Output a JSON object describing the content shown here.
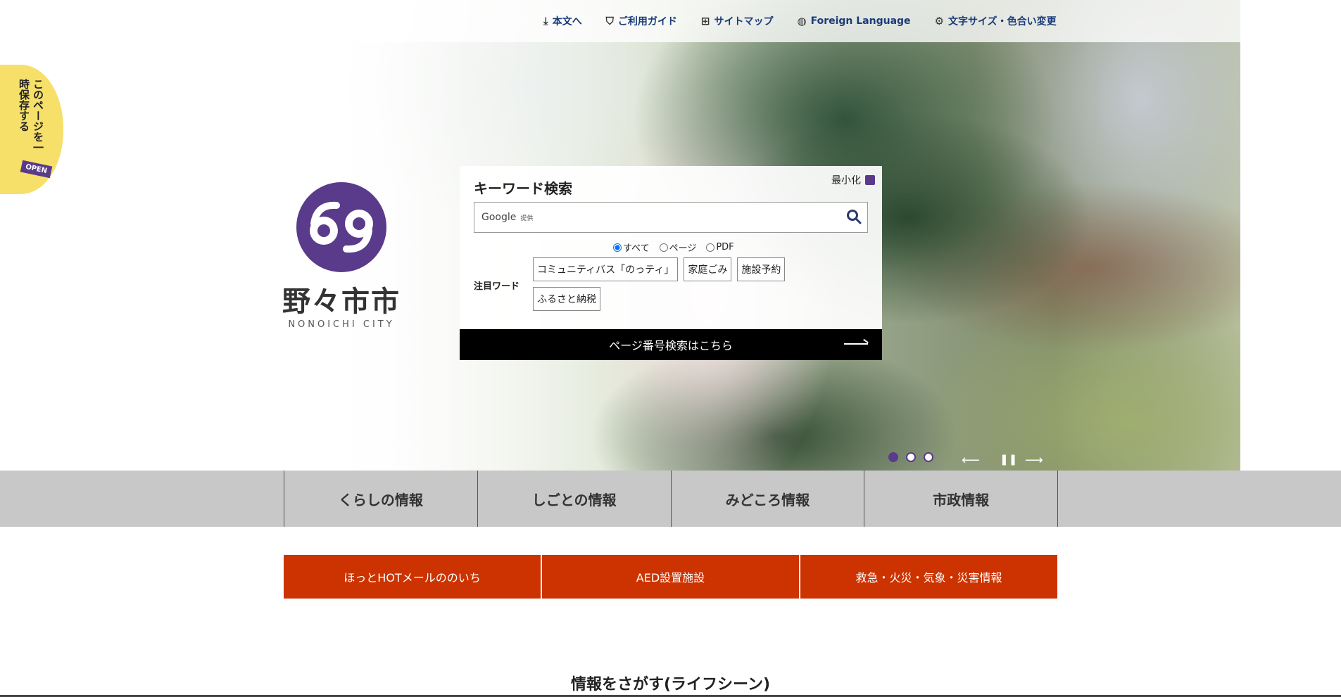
{
  "util_nav": [
    {
      "icon": "down-arrow-icon",
      "label": "本文へ"
    },
    {
      "icon": "guide-shield-icon",
      "label": "ご利用ガイド"
    },
    {
      "icon": "sitemap-icon",
      "label": "サイトマップ"
    },
    {
      "icon": "globe-icon",
      "label": "Foreign Language"
    },
    {
      "icon": "settings-icon",
      "label": "文字サイズ・色合い変更"
    }
  ],
  "save_tab": {
    "text": "このページを一時保存する",
    "badge": "OPEN"
  },
  "logo": {
    "jp": "野々市市",
    "en": "NONOICHI CITY"
  },
  "search": {
    "title": "キーワード検索",
    "minimize": "最小化",
    "placeholder": "Google",
    "placeholder_small": "提供",
    "radios": [
      "すべて",
      "ページ",
      "PDF"
    ],
    "featured_label": "注目ワード",
    "tags": [
      "コミュニティバス「のっティ」",
      "家庭ごみ",
      "施設予約",
      "ふるさと納税"
    ],
    "page_number_button": "ページ番号検索はこちら"
  },
  "slider": {
    "prev": "⟵",
    "pause": "❚❚",
    "next": "⟶"
  },
  "global_nav": [
    "くらしの情報",
    "しごとの情報",
    "みどころ情報",
    "市政情報"
  ],
  "quick_links": [
    "ほっとHOTメールののいち",
    "AED設置施設",
    "救急・火災・気象・災害情報"
  ],
  "section_title": "情報をさがす(ライフシーン)",
  "colors": {
    "brand_purple": "#5a3a8a",
    "accent_red": "#cc3300",
    "nav_gray": "#c8c8c8"
  }
}
